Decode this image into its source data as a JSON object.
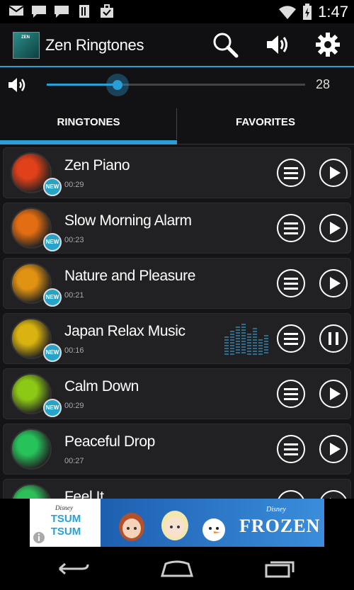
{
  "status_bar": {
    "time": "1:47",
    "left_icons": [
      "gmail-icon",
      "chat-icon",
      "chat-icon",
      "sim-icon",
      "briefcase-icon"
    ],
    "right_icons": [
      "wifi-icon",
      "battery-icon"
    ]
  },
  "app": {
    "title": "Zen Ringtones",
    "icon_text": "ZEN",
    "actions": [
      "search-icon",
      "volume-icon",
      "settings-icon"
    ]
  },
  "volume": {
    "value": "28",
    "fraction": 0.28
  },
  "tabs": [
    {
      "label": "RINGTONES",
      "selected": true
    },
    {
      "label": "FAVORITES",
      "selected": false
    }
  ],
  "badge_text": "NEW",
  "ringtones": [
    {
      "title": "Zen Piano",
      "duration": "00:29",
      "new": true,
      "playing": false,
      "color": "#e0401a"
    },
    {
      "title": "Slow Morning Alarm",
      "duration": "00:23",
      "new": true,
      "playing": false,
      "color": "#e26d12"
    },
    {
      "title": "Nature and Pleasure",
      "duration": "00:21",
      "new": true,
      "playing": false,
      "color": "#e09212"
    },
    {
      "title": "Japan Relax Music",
      "duration": "00:16",
      "new": true,
      "playing": true,
      "color": "#d9b310"
    },
    {
      "title": "Calm Down",
      "duration": "00:29",
      "new": true,
      "playing": false,
      "color": "#8cc816"
    },
    {
      "title": "Peaceful Drop",
      "duration": "00:27",
      "new": false,
      "playing": false,
      "color": "#27c25a"
    },
    {
      "title": "Feel It",
      "duration": "",
      "new": false,
      "playing": false,
      "color": "#2fbf5a"
    }
  ],
  "ad": {
    "left_text": "TSUM TSUM",
    "left_brand": "Disney",
    "right_brand": "Disney",
    "right_text": "FROZEN",
    "info_icon": "info-icon"
  },
  "nav": [
    "back-icon",
    "home-icon",
    "recents-icon"
  ],
  "colors": {
    "accent": "#2a9fd6",
    "badge": "#27a3c7"
  }
}
